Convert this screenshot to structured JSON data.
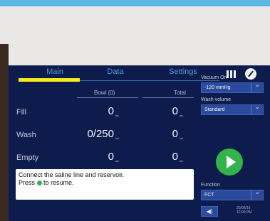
{
  "tabs": {
    "main": "Main",
    "data": "Data",
    "settings": "Settings"
  },
  "table": {
    "headers": {
      "bowl": "Bowl (0)",
      "total": "Total"
    },
    "unit": "mL",
    "rows": [
      {
        "label": "Fill",
        "bowl": "0",
        "total": "0"
      },
      {
        "label": "Wash",
        "bowl": "0/250",
        "total": "0"
      },
      {
        "label": "Empty",
        "bowl": "0",
        "total": "0"
      }
    ]
  },
  "message": {
    "line1": "Connect the saline line and reservoir.",
    "line2_prefix": "Press",
    "line2_suffix": "to resume."
  },
  "settings_panel": {
    "vacuum_label": "Vacuum On",
    "vacuum_value": "-120 mmHg",
    "wash_label": "Wash volume",
    "wash_value": "Standard",
    "function_label": "Function",
    "function_value": "FCT"
  },
  "status": {
    "date": "20/06/16",
    "time": "12:00 PM"
  },
  "icons": [
    "grid-icon",
    "wrench-icon",
    "play-icon",
    "speaker-icon",
    "chevron-down-icon"
  ],
  "colors": {
    "accent": "#f4ea1c",
    "play": "#34b34a",
    "screen_bg": "#0e1c4d",
    "tab_text": "#4d9ad6"
  }
}
